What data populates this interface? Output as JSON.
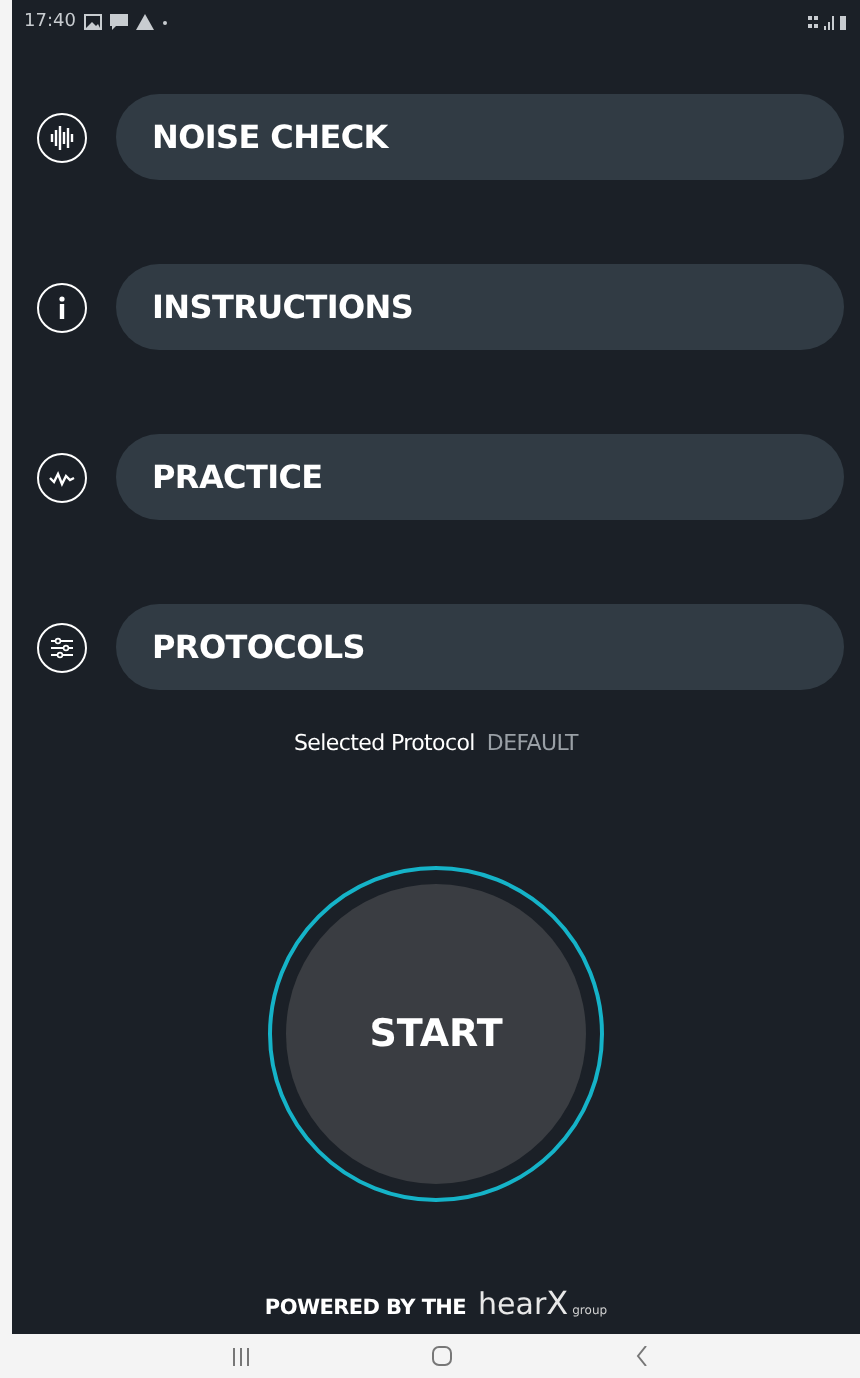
{
  "status_bar": {
    "time": "17:40"
  },
  "menu": [
    {
      "label": "NOISE CHECK"
    },
    {
      "label": "INSTRUCTIONS"
    },
    {
      "label": "PRACTICE"
    },
    {
      "label": "PROTOCOLS"
    }
  ],
  "selected_protocol": {
    "label": "Selected Protocol",
    "value": "DEFAULT"
  },
  "start_button": {
    "label": "START"
  },
  "footer": {
    "powered_by": "POWERED BY THE",
    "logo_main": "hear",
    "logo_x": "X",
    "logo_sub": "group"
  }
}
